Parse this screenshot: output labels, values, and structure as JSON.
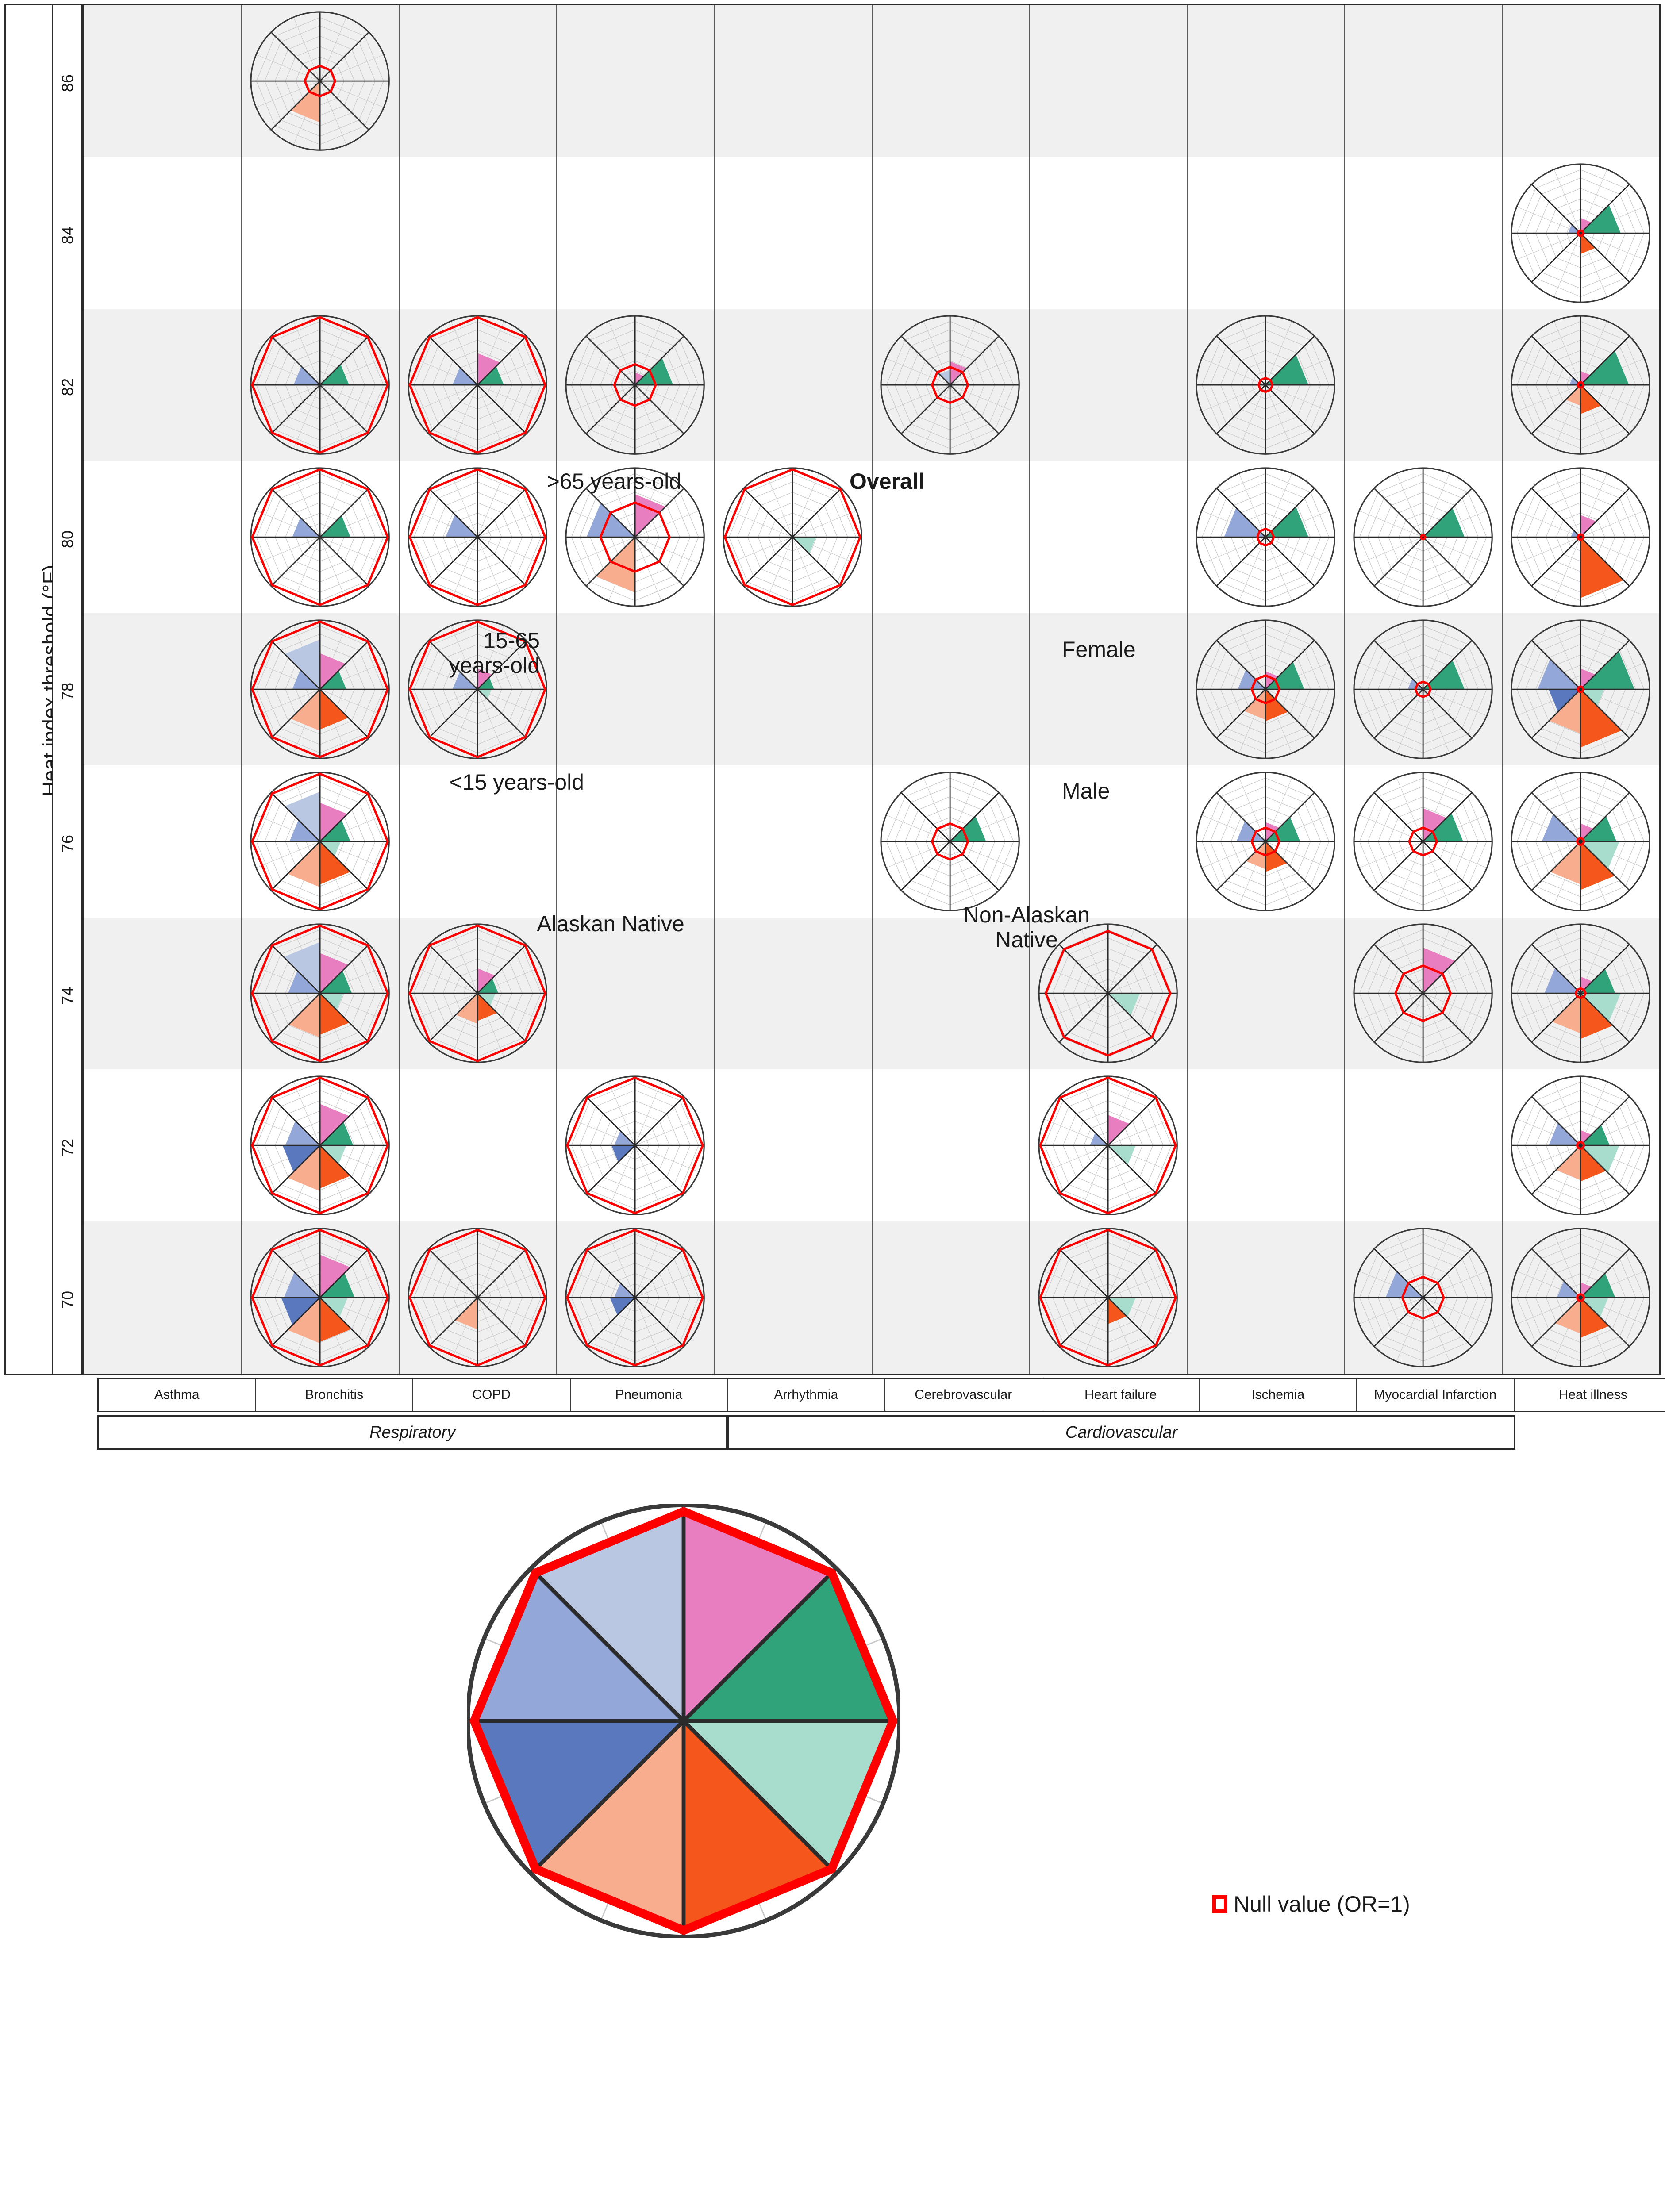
{
  "axis": {
    "y_title": "Heat index threshold (°F)",
    "y_ticks": [
      86,
      84,
      82,
      80,
      78,
      76,
      74,
      72,
      70
    ]
  },
  "columns": [
    {
      "label": "Asthma",
      "group": "Respiratory"
    },
    {
      "label": "Bronchitis",
      "group": "Respiratory"
    },
    {
      "label": "COPD",
      "group": "Respiratory"
    },
    {
      "label": "Pneumonia",
      "group": "Respiratory"
    },
    {
      "label": "Arrhythmia",
      "group": "Cardiovascular"
    },
    {
      "label": "Cerebrovascular",
      "group": "Cardiovascular"
    },
    {
      "label": "Heart failure",
      "group": "Cardiovascular"
    },
    {
      "label": "Ischemia",
      "group": "Cardiovascular"
    },
    {
      "label": "Myocardial Infarction",
      "group": "Cardiovascular"
    },
    {
      "label": "Heat illness",
      "group": ""
    }
  ],
  "groups": [
    {
      "label": "Respiratory",
      "start": 0,
      "end": 3
    },
    {
      "label": "Cardiovascular",
      "start": 4,
      "end": 8
    }
  ],
  "legend": {
    "null_label": "Null value (OR=1)",
    "null_color": "#ff0000",
    "sector_labels": [
      "Overall",
      "Female",
      "Male",
      "Non-Alaskan\nNative",
      "Alaskan Native",
      "<15 years-old",
      "15-65\nyears-old",
      ">65 years-old"
    ],
    "bold_label": "Overall"
  },
  "colors": {
    "overall": "#e87ec0",
    "female": "#30a37a",
    "male": "#a8ddcd",
    "non_alaskan_native": "#f4561b",
    "alaskan_native": "#f8ad8e",
    "under15": "#5a78bd",
    "age15_65": "#93a7d8",
    "over65": "#b9c7e2",
    "null_ring": "#ff0000",
    "grid": "#c9c9c9",
    "spoke": "#2b2b2b",
    "band": "#f0f0f0"
  },
  "chart_data": {
    "type": "radar",
    "title": "",
    "xlabel": "",
    "ylabel": "Heat index threshold (°F)",
    "sector_order": [
      "Overall",
      "Female",
      "Male",
      "Non-Alaskan Native",
      "Alaskan Native",
      "<15 years-old",
      "15-65 years-old",
      ">65 years-old"
    ],
    "sector_start_angle_deg": -90,
    "sector_span_deg": 45,
    "null_reference": 1.0,
    "radial_note": "Sector radius encodes odds ratio; red octagon marks OR = 1",
    "cells": [
      {
        "row": 86,
        "col": "Bronchitis",
        "null_r": 0.22,
        "values": [
          0,
          0,
          0,
          0,
          0.6,
          0,
          0,
          0
        ]
      },
      {
        "row": 84,
        "col": "Heat illness",
        "null_r": 0.04,
        "values": [
          0.22,
          0.58,
          0,
          0.3,
          0,
          0,
          0.18,
          0
        ]
      },
      {
        "row": 82,
        "col": "Bronchitis",
        "null_r": 0.98,
        "values": [
          0,
          0.42,
          0,
          0,
          0,
          0,
          0.38,
          0
        ]
      },
      {
        "row": 82,
        "col": "COPD",
        "null_r": 0.98,
        "values": [
          0.46,
          0.38,
          0,
          0,
          0,
          0,
          0.36,
          0
        ]
      },
      {
        "row": 82,
        "col": "Pneumonia",
        "null_r": 0.3,
        "values": [
          0.18,
          0.55,
          0,
          0,
          0,
          0,
          0,
          0
        ]
      },
      {
        "row": 82,
        "col": "Cerebrovascular",
        "null_r": 0.26,
        "values": [
          0.34,
          0,
          0,
          0,
          0,
          0,
          0,
          0.22
        ]
      },
      {
        "row": 82,
        "col": "Ischemia",
        "null_r": 0.1,
        "values": [
          0,
          0.62,
          0,
          0,
          0,
          0,
          0,
          0
        ]
      },
      {
        "row": 82,
        "col": "Heat illness",
        "null_r": 0.04,
        "values": [
          0.2,
          0.7,
          0,
          0.42,
          0.3,
          0,
          0.16,
          0
        ]
      },
      {
        "row": 80,
        "col": "Bronchitis",
        "null_r": 0.98,
        "values": [
          0,
          0.44,
          0,
          0,
          0,
          0,
          0.4,
          0
        ]
      },
      {
        "row": 80,
        "col": "COPD",
        "null_r": 0.98,
        "values": [
          0,
          0,
          0,
          0,
          0,
          0,
          0.46,
          0
        ]
      },
      {
        "row": 80,
        "col": "Pneumonia",
        "null_r": 0.5,
        "values": [
          0.62,
          0,
          0,
          0,
          0.8,
          0,
          0.7,
          0
        ]
      },
      {
        "row": 80,
        "col": "Arrhythmia",
        "null_r": 0.98,
        "values": [
          0,
          0,
          0.34,
          0,
          0,
          0,
          0,
          0
        ]
      },
      {
        "row": 80,
        "col": "Ischemia",
        "null_r": 0.12,
        "values": [
          0,
          0.62,
          0,
          0,
          0,
          0,
          0.6,
          0
        ]
      },
      {
        "row": 80,
        "col": "Myocardial Infarction",
        "null_r": 0.03,
        "values": [
          0,
          0.6,
          0,
          0,
          0,
          0,
          0,
          0
        ]
      },
      {
        "row": 80,
        "col": "Heat illness",
        "null_r": 0.04,
        "values": [
          0.32,
          0,
          0,
          0.88,
          0,
          0,
          0.14,
          0
        ]
      },
      {
        "row": 78,
        "col": "Bronchitis",
        "null_r": 0.98,
        "values": [
          0.52,
          0.38,
          0,
          0.58,
          0.6,
          0,
          0.4,
          0.72
        ]
      },
      {
        "row": 78,
        "col": "COPD",
        "null_r": 0.98,
        "values": [
          0.3,
          0.24,
          0.2,
          0,
          0,
          0,
          0.36,
          0
        ]
      },
      {
        "row": 78,
        "col": "Ischemia",
        "null_r": 0.2,
        "values": [
          0.26,
          0.56,
          0,
          0.46,
          0.44,
          0,
          0.4,
          0
        ]
      },
      {
        "row": 78,
        "col": "Myocardial Infarction",
        "null_r": 0.11,
        "values": [
          0,
          0.6,
          0,
          0,
          0,
          0,
          0.22,
          0
        ]
      },
      {
        "row": 78,
        "col": "Heat illness",
        "null_r": 0.04,
        "values": [
          0.3,
          0.78,
          0.34,
          0.84,
          0.64,
          0.46,
          0.62,
          0
        ]
      },
      {
        "row": 76,
        "col": "Bronchitis",
        "null_r": 0.98,
        "values": [
          0.56,
          0.44,
          0.3,
          0.62,
          0.66,
          0,
          0.44,
          0.72
        ]
      },
      {
        "row": 76,
        "col": "Cerebrovascular",
        "null_r": 0.26,
        "values": [
          0,
          0.52,
          0,
          0,
          0,
          0,
          0,
          0
        ]
      },
      {
        "row": 76,
        "col": "Ischemia",
        "null_r": 0.2,
        "values": [
          0.28,
          0.5,
          0,
          0.44,
          0.4,
          0,
          0.42,
          0
        ]
      },
      {
        "row": 76,
        "col": "Myocardial Infarction",
        "null_r": 0.2,
        "values": [
          0.48,
          0.58,
          0,
          0,
          0,
          0,
          0,
          0
        ]
      },
      {
        "row": 76,
        "col": "Heat illness",
        "null_r": 0.05,
        "values": [
          0.26,
          0.52,
          0.56,
          0.7,
          0.62,
          0,
          0.56,
          0
        ]
      },
      {
        "row": 74,
        "col": "Bronchitis",
        "null_r": 0.98,
        "values": [
          0.58,
          0.46,
          0.34,
          0.6,
          0.64,
          0,
          0.46,
          0.74
        ]
      },
      {
        "row": 74,
        "col": "COPD",
        "null_r": 0.98,
        "values": [
          0.36,
          0.3,
          0.26,
          0.4,
          0.44,
          0,
          0,
          0
        ]
      },
      {
        "row": 74,
        "col": "Heart failure",
        "null_r": 0.9,
        "values": [
          0,
          0,
          0.46,
          0,
          0,
          0,
          0,
          0
        ]
      },
      {
        "row": 74,
        "col": "Myocardial Infarction",
        "null_r": 0.4,
        "values": [
          0.66,
          0,
          0,
          0,
          0,
          0,
          0,
          0
        ]
      },
      {
        "row": 74,
        "col": "Heat illness",
        "null_r": 0.07,
        "values": [
          0.24,
          0.5,
          0.58,
          0.66,
          0.58,
          0,
          0.52,
          0
        ]
      },
      {
        "row": 72,
        "col": "Bronchitis",
        "null_r": 0.98,
        "values": [
          0.6,
          0.48,
          0.38,
          0.62,
          0.66,
          0.54,
          0.5,
          0
        ]
      },
      {
        "row": 72,
        "col": "Pneumonia",
        "null_r": 0.98,
        "values": [
          0,
          0,
          0,
          0,
          0,
          0.34,
          0.3,
          0
        ]
      },
      {
        "row": 72,
        "col": "Heart failure",
        "null_r": 0.98,
        "values": [
          0.44,
          0,
          0.4,
          0,
          0,
          0,
          0.26,
          0
        ]
      },
      {
        "row": 72,
        "col": "Heat illness",
        "null_r": 0.05,
        "values": [
          0.22,
          0.42,
          0.56,
          0.52,
          0.5,
          0,
          0.46,
          0
        ]
      },
      {
        "row": 70,
        "col": "Bronchitis",
        "null_r": 0.98,
        "values": [
          0.62,
          0.5,
          0.4,
          0.64,
          0.66,
          0.56,
          0.52,
          0
        ]
      },
      {
        "row": 70,
        "col": "COPD",
        "null_r": 0.98,
        "values": [
          0,
          0,
          0,
          0,
          0.46,
          0,
          0,
          0
        ]
      },
      {
        "row": 70,
        "col": "Pneumonia",
        "null_r": 0.98,
        "values": [
          0,
          0,
          0,
          0,
          0,
          0.36,
          0.3,
          0
        ]
      },
      {
        "row": 70,
        "col": "Heart failure",
        "null_r": 0.98,
        "values": [
          0,
          0,
          0.4,
          0.38,
          0,
          0,
          0,
          0
        ]
      },
      {
        "row": 70,
        "col": "Myocardial Infarction",
        "null_r": 0.3,
        "values": [
          0,
          0,
          0,
          0,
          0,
          0,
          0.54,
          0
        ]
      },
      {
        "row": 70,
        "col": "Heat illness",
        "null_r": 0.05,
        "values": [
          0.22,
          0.5,
          0.4,
          0.58,
          0.52,
          0,
          0.34,
          0
        ]
      }
    ]
  }
}
